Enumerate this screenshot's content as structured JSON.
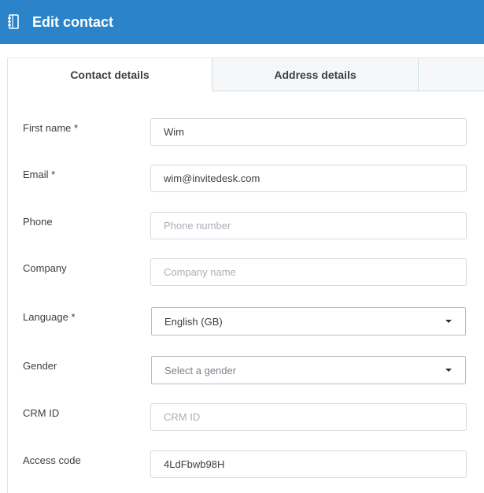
{
  "header": {
    "title": "Edit contact",
    "icon": "address-book-icon",
    "background": "#2b84c9"
  },
  "tabs": [
    {
      "label": "Contact details",
      "active": true
    },
    {
      "label": "Address details",
      "active": false
    }
  ],
  "form": {
    "first_name": {
      "label": "First name *",
      "value": "Wim",
      "placeholder": ""
    },
    "email": {
      "label": "Email *",
      "value": "wim@invitedesk.com",
      "placeholder": ""
    },
    "phone": {
      "label": "Phone",
      "value": "",
      "placeholder": "Phone number"
    },
    "company": {
      "label": "Company",
      "value": "",
      "placeholder": "Company name"
    },
    "language": {
      "label": "Language *",
      "selected": "English (GB)"
    },
    "gender": {
      "label": "Gender",
      "selected": "",
      "placeholder": "Select a gender"
    },
    "crm_id": {
      "label": "CRM ID",
      "value": "",
      "placeholder": "CRM ID"
    },
    "access_code": {
      "label": "Access code",
      "value": "4LdFbwb98H",
      "placeholder": ""
    }
  }
}
